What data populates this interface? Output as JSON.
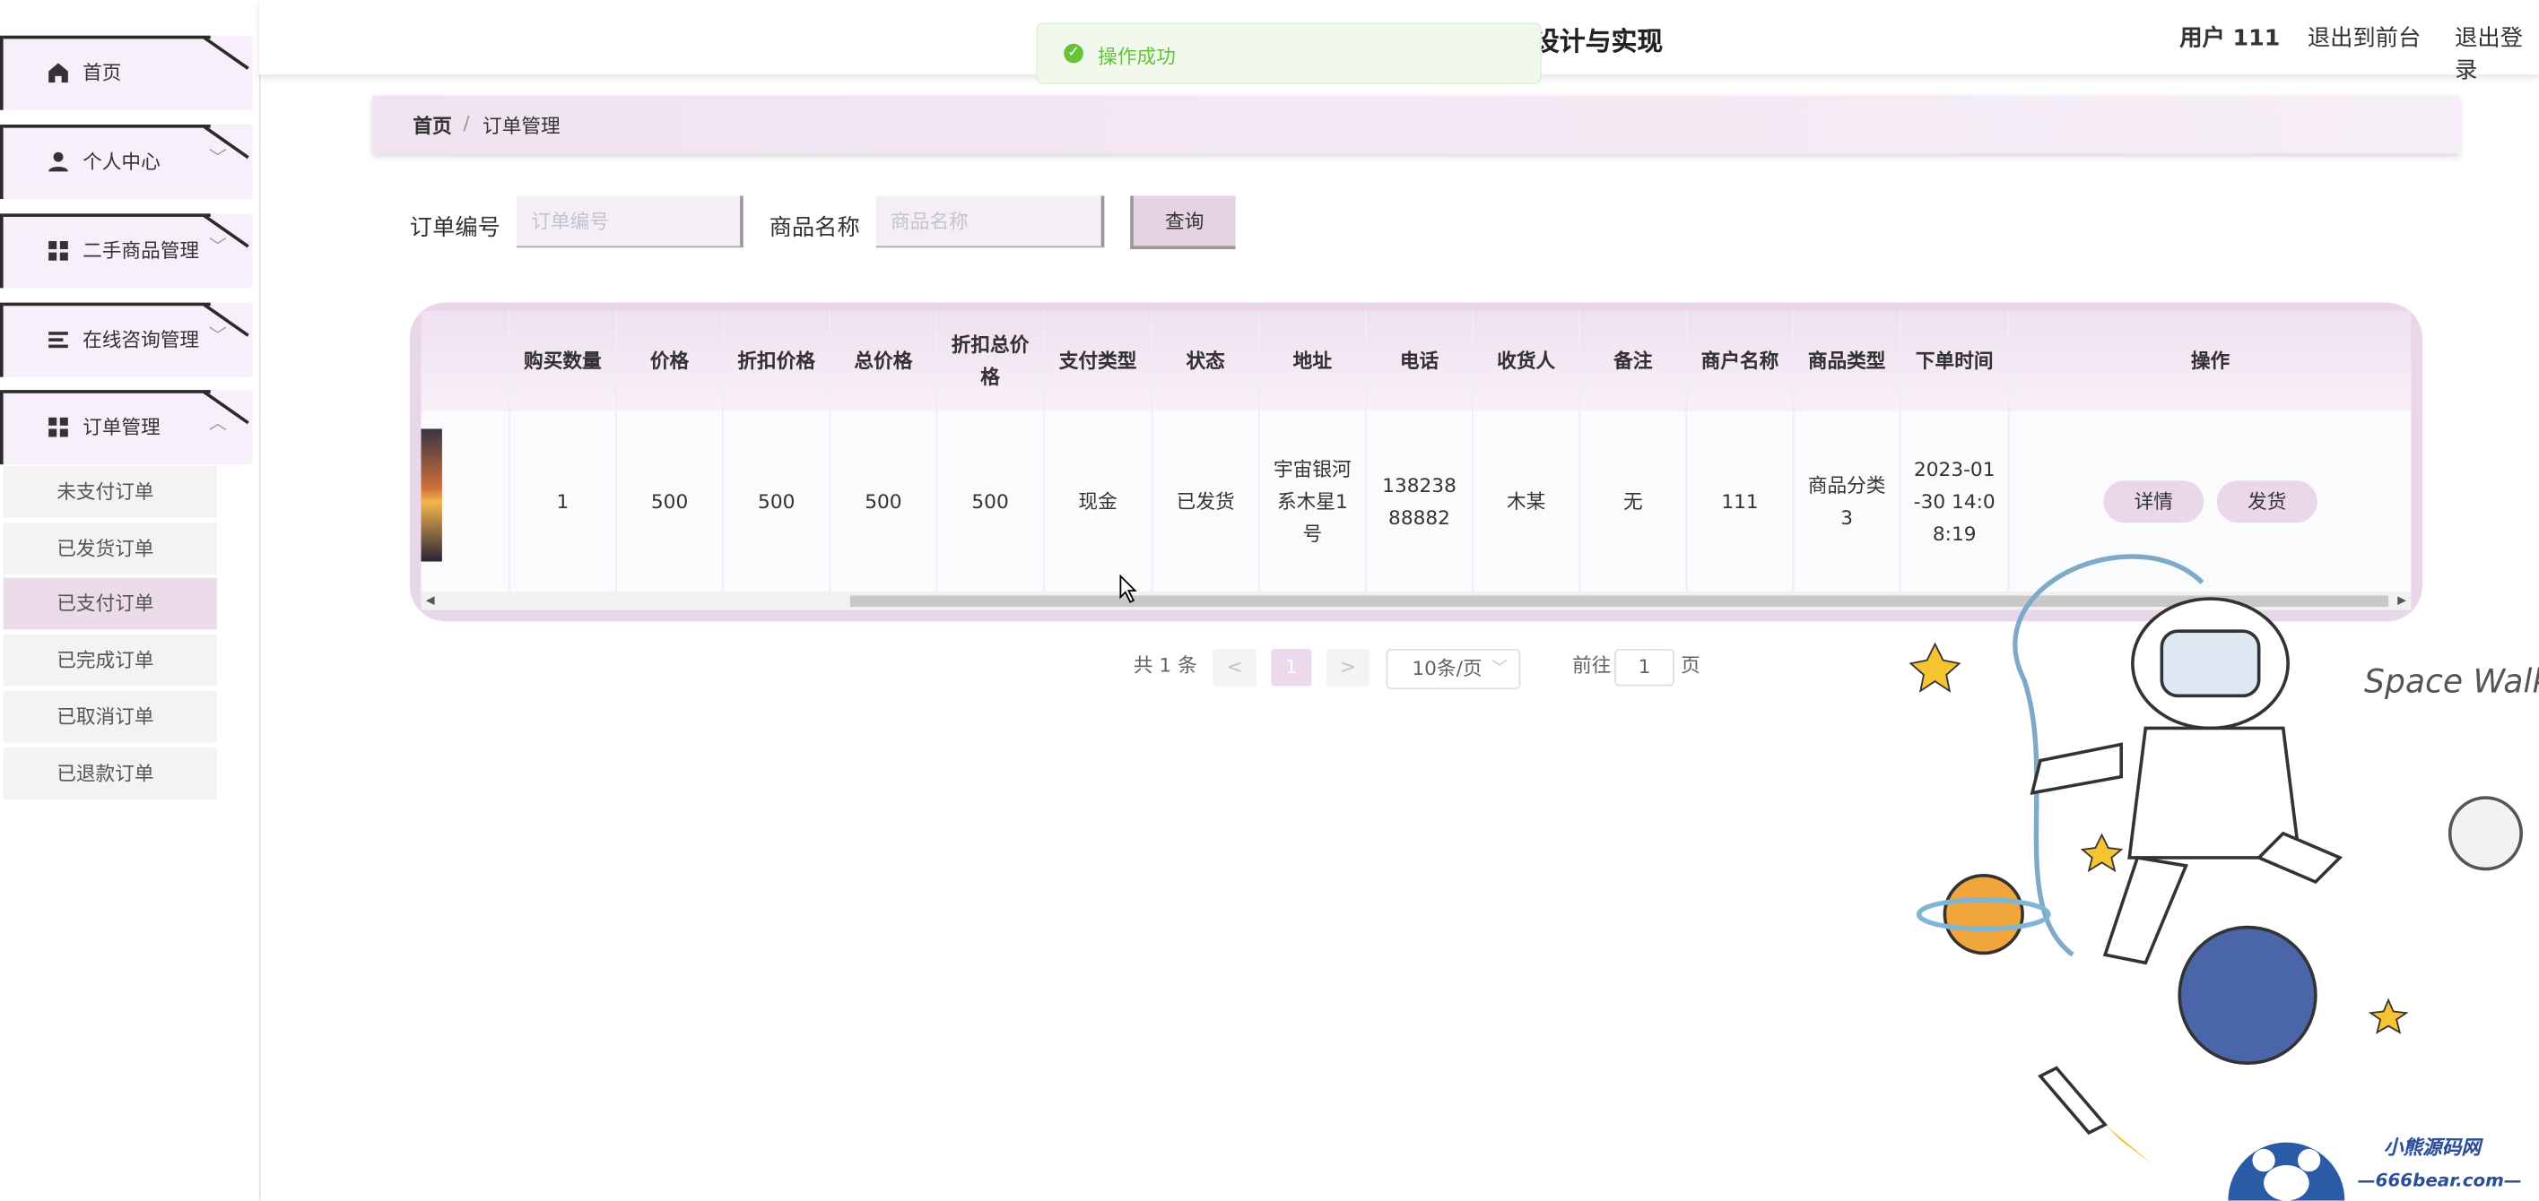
{
  "header": {
    "title": "设计与实现",
    "user": "用户 111",
    "nav_front": "退出到前台",
    "nav_logout": "退出登录"
  },
  "toast": {
    "text": "操作成功"
  },
  "sidebar": {
    "items": [
      {
        "label": "首页",
        "icon": "home-icon"
      },
      {
        "label": "个人中心",
        "icon": "user-icon"
      },
      {
        "label": "二手商品管理",
        "icon": "grid-icon"
      },
      {
        "label": "在线咨询管理",
        "icon": "list-icon"
      },
      {
        "label": "订单管理",
        "icon": "grid-icon"
      }
    ],
    "subitems": [
      "未支付订单",
      "已发货订单",
      "已支付订单",
      "已完成订单",
      "已取消订单",
      "已退款订单"
    ],
    "active_sub": "已支付订单"
  },
  "breadcrumb": {
    "home": "首页",
    "sep": "/",
    "current": "订单管理"
  },
  "search": {
    "order_label": "订单编号",
    "order_placeholder": "订单编号",
    "name_label": "商品名称",
    "name_placeholder": "商品名称",
    "query_button": "查询"
  },
  "table": {
    "headers": [
      "购买数量",
      "价格",
      "折扣价格",
      "总价格",
      "折扣总价格",
      "支付类型",
      "状态",
      "地址",
      "电话",
      "收货人",
      "备注",
      "商户名称",
      "商品类型",
      "下单时间",
      "操作"
    ],
    "rows": [
      {
        "qty": "1",
        "price": "500",
        "discount_price": "500",
        "total": "500",
        "discount_total": "500",
        "pay_type": "现金",
        "status": "已发货",
        "address": "宇宙银河系木星1号",
        "phone": "13823888882",
        "receiver": "木某",
        "remark": "无",
        "merchant": "111",
        "goods_type": "商品分类3",
        "order_time": "2023-01-30 14:08:19",
        "detail_button": "详情",
        "ship_button": "发货"
      }
    ]
  },
  "pagination": {
    "total": "共 1 条",
    "prev": "<",
    "current_page": "1",
    "next": ">",
    "page_size": "10条/页",
    "goto_prefix": "前往",
    "goto_value": "1",
    "goto_suffix": "页"
  },
  "watermark": {
    "line1": "小熊源码网",
    "line2": "—666bear.com—"
  },
  "deco_text": "Space Walk"
}
